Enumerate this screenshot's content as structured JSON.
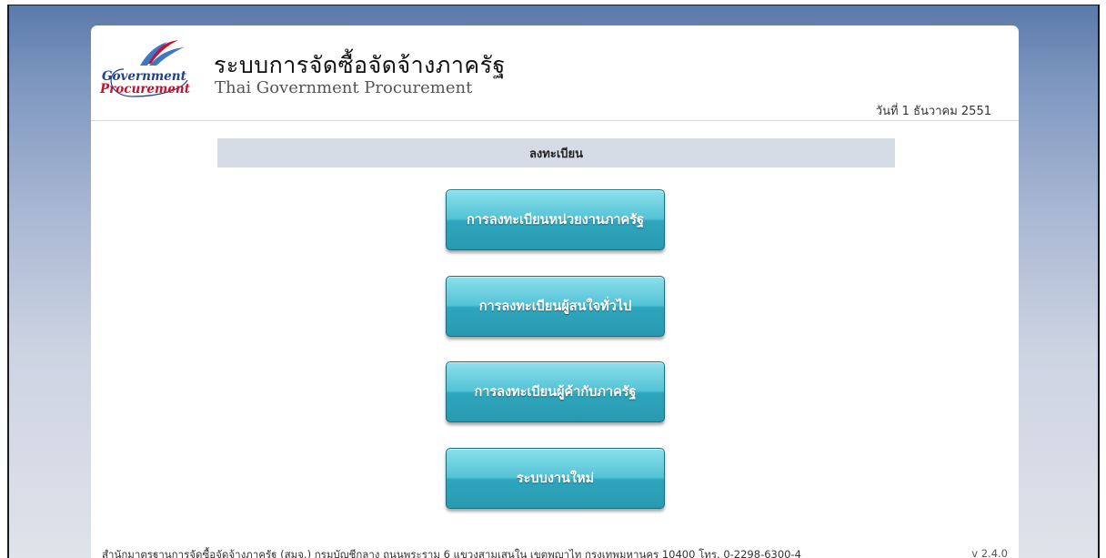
{
  "logo": {
    "line1": "Government",
    "line2": "Procurement",
    "colors": {
      "blue": "#1f3f8f",
      "red": "#c8102e",
      "swoosh_blue": "#3d78c4"
    }
  },
  "header": {
    "title_th": "ระบบการจัดซื้อจัดจ้างภาครัฐ",
    "title_en": "Thai Government Procurement",
    "date": "วันที่ 1 ธันวาคม 2551"
  },
  "section": {
    "title": "ลงทะเบียน"
  },
  "buttons": [
    {
      "label": "การลงทะเบียนหน่วยงานภาครัฐ"
    },
    {
      "label": "การลงทะเบียนผู้สนใจทั่วไป"
    },
    {
      "label": "การลงทะเบียนผู้ค้ากับภาครัฐ"
    },
    {
      "label": "ระบบงานใหม่"
    }
  ],
  "footer": {
    "address": "สำนักมาตรฐานการจัดซื้อจัดจ้างภาครัฐ (สมจ.) กรมบัญชีกลาง ถนนพระราม 6 แขวงสามเสนใน เขตพญาไท กรุงเทพมหานคร 10400 โทร. 0-2298-6300-4",
    "version": "v 2.4.0"
  },
  "theme": {
    "button_color": "#3fb3c8",
    "section_bar": "#d5dce6",
    "background_top": "#5a7aaa"
  }
}
